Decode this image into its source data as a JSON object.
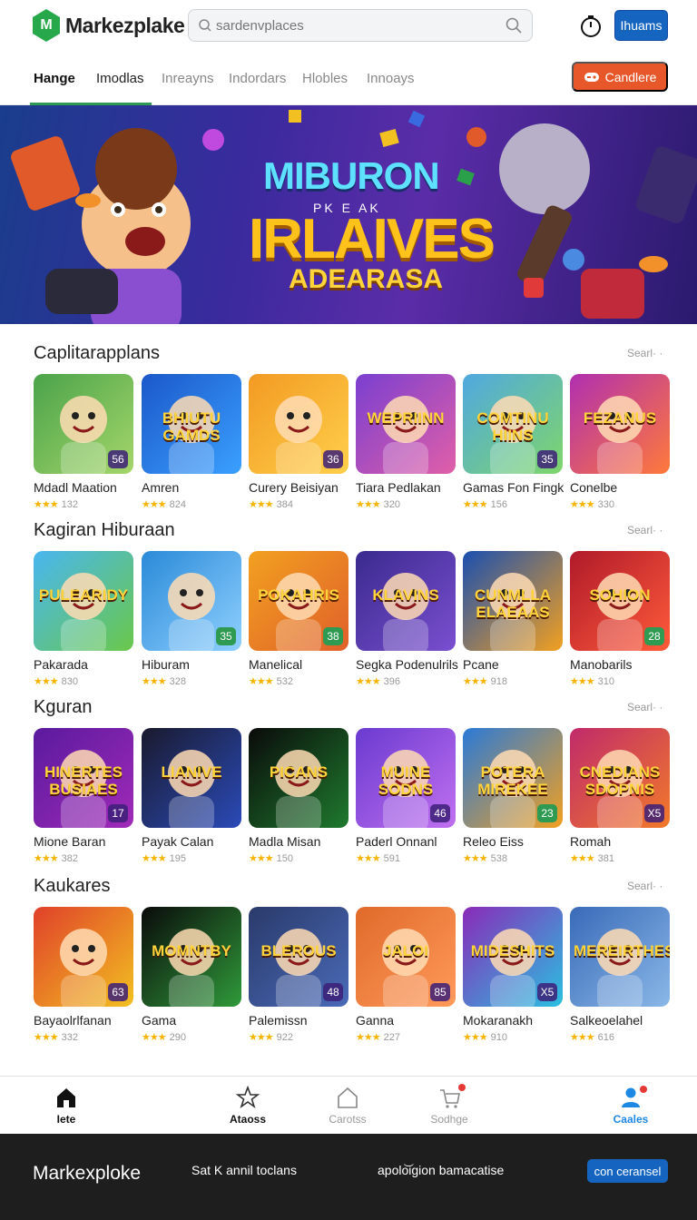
{
  "header": {
    "logo_text": "Markezplake",
    "search_placeholder": "sardenvplaces",
    "login_label": "Ihuams"
  },
  "tabs": {
    "items": [
      "Hange",
      "Imodlas",
      "Inreayns",
      "Indordars",
      "Hlobles",
      "Innoays"
    ],
    "cta_label": "Candlere"
  },
  "hero": {
    "line1": "MIBURON",
    "line2": "PK E AK",
    "line3": "IRLAIVES",
    "line4": "ADEARASA"
  },
  "sections": [
    {
      "title": "Caplitarapplans",
      "more": "Searl· ·",
      "apps": [
        {
          "name": "Mdadl Maation",
          "rating": "132",
          "badge": "56",
          "art": "",
          "colors": [
            "#4aa34a",
            "#a5d66a"
          ]
        },
        {
          "name": "Amren",
          "rating": "824",
          "badge": "",
          "art": "BHIUTU GAMDS",
          "colors": [
            "#1b58c9",
            "#3aa0ff"
          ]
        },
        {
          "name": "Curery Beisiyan",
          "rating": "384",
          "badge": "36",
          "art": "",
          "colors": [
            "#f29a22",
            "#ffcf4a"
          ]
        },
        {
          "name": "Tiara Pedlakan",
          "rating": "320",
          "badge": "",
          "art": "WEPRIINN",
          "colors": [
            "#7a3fd0",
            "#e05fa8"
          ]
        },
        {
          "name": "Gamas Fon Fingk",
          "rating": "156",
          "badge": "35",
          "art": "COMTINU HIINS",
          "colors": [
            "#4fa8e0",
            "#7fd66a"
          ]
        },
        {
          "name": "Conelbe",
          "rating": "330",
          "badge": "",
          "art": "FEZANUS",
          "colors": [
            "#b02fb0",
            "#ff7a3a"
          ]
        }
      ]
    },
    {
      "title": "Kagiran Hiburaan",
      "more": "Searl· ·",
      "apps": [
        {
          "name": "Pakarada",
          "rating": "830",
          "badge": "",
          "art": "PULEARIDY",
          "colors": [
            "#49b6f0",
            "#6ac84a"
          ]
        },
        {
          "name": "Hiburam",
          "rating": "328",
          "badge": "35",
          "art": "",
          "colors": [
            "#2a8ad8",
            "#8fd0ff"
          ]
        },
        {
          "name": "Manelical",
          "rating": "532",
          "badge": "38",
          "art": "POKAHRIS",
          "colors": [
            "#f2a020",
            "#e0602a"
          ]
        },
        {
          "name": "Segka Podenulrils",
          "rating": "396",
          "badge": "",
          "art": "KLAVINS",
          "colors": [
            "#3a2a8e",
            "#7a4fd0"
          ]
        },
        {
          "name": "Pcane",
          "rating": "918",
          "badge": "",
          "art": "CUNMLLA ELAEAAS",
          "colors": [
            "#1a4fb0",
            "#f2a020"
          ]
        },
        {
          "name": "Manobarils",
          "rating": "310",
          "badge": "28",
          "art": "SOHION",
          "colors": [
            "#b01a2a",
            "#ff5a3a"
          ]
        }
      ]
    },
    {
      "title": "Kguran",
      "more": "Searl· ·",
      "apps": [
        {
          "name": "Mione Baran",
          "rating": "382",
          "badge": "17",
          "art": "HINERTES BUSIAES",
          "colors": [
            "#5a1a9e",
            "#a02ab8"
          ]
        },
        {
          "name": "Payak Calan",
          "rating": "195",
          "badge": "",
          "art": "LIANIVE",
          "colors": [
            "#1a1a2e",
            "#2a4ab8"
          ]
        },
        {
          "name": "Madla Misan",
          "rating": "150",
          "badge": "",
          "art": "PICANS",
          "colors": [
            "#0a0a0a",
            "#1f7a2e"
          ]
        },
        {
          "name": "Paderl Onnanl",
          "rating": "591",
          "badge": "46",
          "art": "MUINE SODNS",
          "colors": [
            "#6a3ad0",
            "#c070f0"
          ]
        },
        {
          "name": "Releo Eiss",
          "rating": "538",
          "badge": "23",
          "art": "POTERA MIREKEE",
          "colors": [
            "#2a7ad8",
            "#f2a020"
          ]
        },
        {
          "name": "Romah",
          "rating": "381",
          "badge": "X5",
          "art": "CNEDIANS SDOPNIS",
          "colors": [
            "#c02a6a",
            "#f27a2a"
          ]
        }
      ]
    },
    {
      "title": "Kaukares",
      "more": "Searl· ·",
      "apps": [
        {
          "name": "Bayaolrlfanan",
          "rating": "332",
          "badge": "63",
          "art": "",
          "colors": [
            "#e0402a",
            "#f2c020"
          ]
        },
        {
          "name": "Gama",
          "rating": "290",
          "badge": "",
          "art": "MOMNTBY",
          "colors": [
            "#0a0a0a",
            "#2f9a3a"
          ]
        },
        {
          "name": "Palemissn",
          "rating": "922",
          "badge": "48",
          "art": "BLEROUS",
          "colors": [
            "#2a3a6a",
            "#4a6ab8"
          ]
        },
        {
          "name": "Ganna",
          "rating": "227",
          "badge": "85",
          "art": "JALOI",
          "colors": [
            "#e06a2a",
            "#ff9a5a"
          ]
        },
        {
          "name": "Mokaranakh",
          "rating": "910",
          "badge": "X5",
          "art": "MIDESHITS",
          "colors": [
            "#8a2ab8",
            "#2ac0e0"
          ]
        },
        {
          "name": "Salkeoelahel",
          "rating": "616",
          "badge": "",
          "art": "MEREIRTHES",
          "colors": [
            "#3a6ab8",
            "#8ab8e8"
          ]
        }
      ]
    }
  ],
  "bottom_nav": [
    {
      "label": "Iete",
      "icon": "home-icon"
    },
    {
      "label": "Ataoss",
      "icon": "star-icon"
    },
    {
      "label": "Carotss",
      "icon": "house-outline-icon"
    },
    {
      "label": "Sodhge",
      "icon": "cart-icon"
    },
    {
      "label": "Caales",
      "icon": "profile-icon"
    }
  ],
  "footer": {
    "brand": "Markexploke",
    "link1": "Sat K annil toclans",
    "link2": "apolo͝igion bamacatise",
    "button": "con ceransel"
  }
}
